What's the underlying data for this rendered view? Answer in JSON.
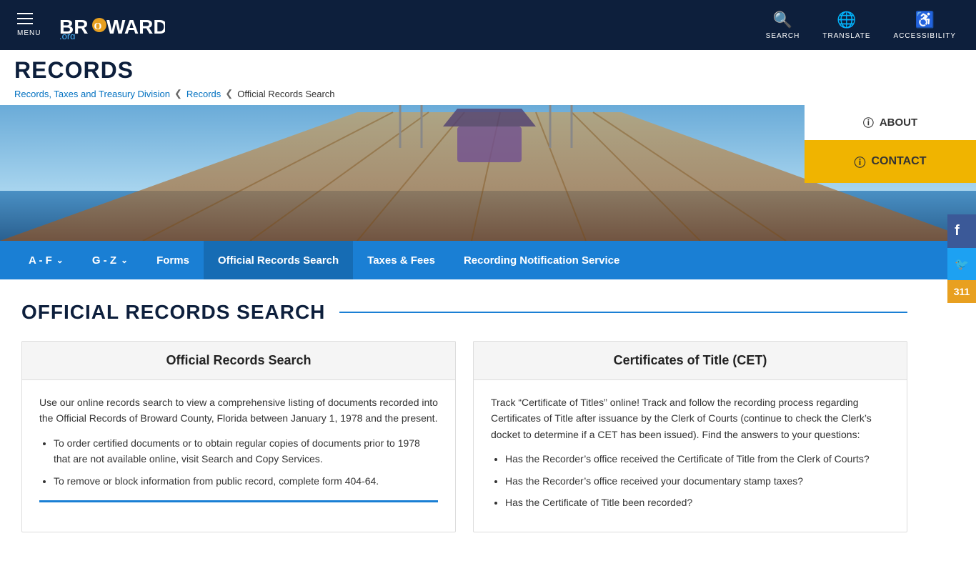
{
  "topnav": {
    "menu_label": "MENU",
    "logo": "BR●WARD.org",
    "search_label": "SEARCH",
    "translate_label": "TRANSLATE",
    "accessibility_label": "ACCESSIBILITY"
  },
  "breadcrumb": {
    "title": "RECORDS",
    "items": [
      {
        "label": "Records, Taxes and Treasury Division",
        "href": "#"
      },
      {
        "label": "Records",
        "href": "#"
      },
      {
        "label": "Official Records Search",
        "href": null
      }
    ]
  },
  "side_buttons": {
    "about_label": "ABOUT",
    "contact_label": "CONTACT"
  },
  "blue_nav": {
    "items": [
      {
        "label": "A - F",
        "has_dropdown": true
      },
      {
        "label": "G - Z",
        "has_dropdown": true
      },
      {
        "label": "Forms",
        "has_dropdown": false
      },
      {
        "label": "Official Records Search",
        "has_dropdown": false,
        "active": true
      },
      {
        "label": "Taxes & Fees",
        "has_dropdown": false
      },
      {
        "label": "Recording Notification Service",
        "has_dropdown": false
      }
    ]
  },
  "page_heading": "OFFICIAL RECORDS SEARCH",
  "cards": [
    {
      "id": "official-records",
      "header": "Official Records Search",
      "body_intro": "Use our online records search to view a comprehensive listing of documents recorded into the Official Records of Broward County, Florida between January 1, 1978 and the present.",
      "bullets": [
        "To order certified documents or to obtain regular copies of documents prior to 1978 that are not available online, visit Search and Copy Services.",
        "To remove or block information from public record, complete form 404-64."
      ]
    },
    {
      "id": "certificates",
      "header": "Certificates of Title (CET)",
      "body_intro": "Track “Certificate of Titles” online! Track and follow the recording process regarding Certificates of Title after issuance by the Clerk of Courts (continue to check the Clerk’s docket to determine if a CET has been issued). Find the answers to your questions:",
      "bullets": [
        "Has the Recorder’s office received the Certificate of Title from the Clerk of Courts?",
        "Has the Recorder’s office received your documentary stamp taxes?",
        "Has the Certificate of Title been recorded?"
      ]
    }
  ],
  "social": {
    "facebook_label": "f",
    "twitter_label": "🐦",
    "badge_311": "311"
  }
}
